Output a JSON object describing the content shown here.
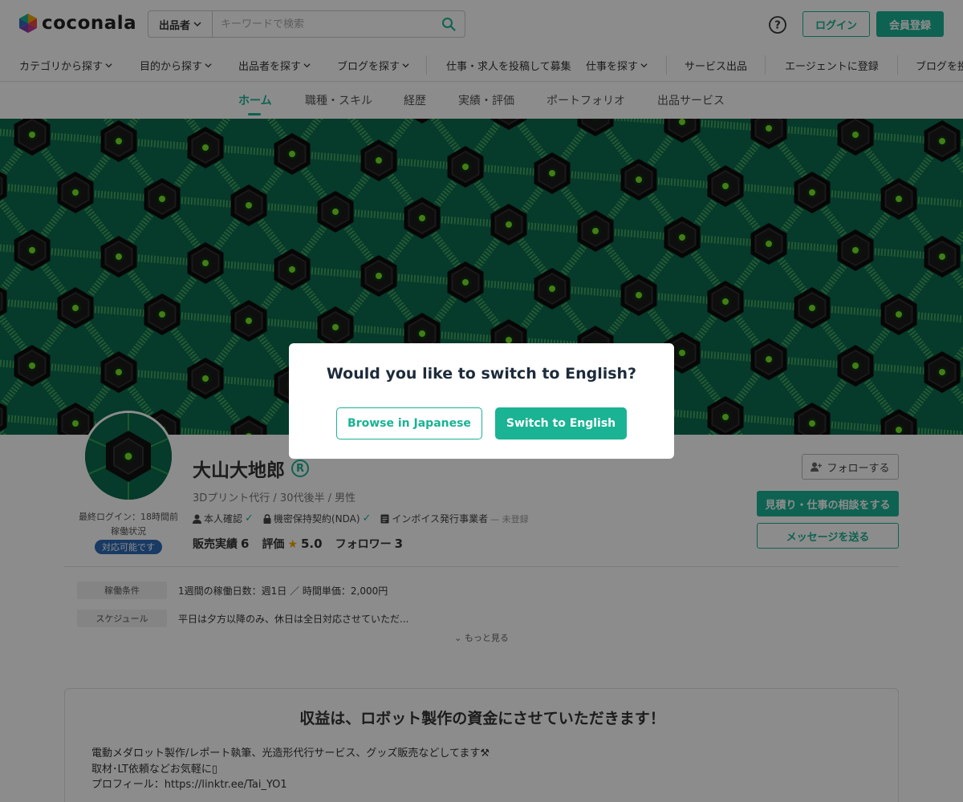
{
  "header": {
    "logo_text": "coconala",
    "search": {
      "type_label": "出品者",
      "placeholder": "キーワードで検索"
    },
    "login_label": "ログイン",
    "register_label": "会員登録",
    "help_icon": "help-circle-icon"
  },
  "global_nav": [
    {
      "label": "カテゴリから探す",
      "dropdown": true
    },
    {
      "label": "目的から探す",
      "dropdown": true
    },
    {
      "label": "出品者を探す",
      "dropdown": true
    },
    {
      "label": "ブログを探す",
      "dropdown": true
    },
    {
      "label": "仕事・求人を投稿して募集",
      "dropdown": false
    },
    {
      "label": "仕事を探す",
      "dropdown": true
    },
    {
      "label": "サービス出品",
      "dropdown": false
    },
    {
      "label": "エージェントに登録",
      "dropdown": false
    },
    {
      "label": "ブログを投",
      "dropdown": false
    }
  ],
  "profile_tabs": [
    {
      "label": "ホーム",
      "active": true
    },
    {
      "label": "職種・スキル",
      "active": false
    },
    {
      "label": "経歴",
      "active": false
    },
    {
      "label": "実績・評価",
      "active": false
    },
    {
      "label": "ポートフォリオ",
      "active": false
    },
    {
      "label": "出品サービス",
      "active": false
    }
  ],
  "profile": {
    "name": "大山大地郎",
    "reg_mark": "R",
    "subinfo": "3Dプリント代行 / 30代後半 / 男性",
    "last_login": "最終ログイン：18時間前",
    "work_status_label": "稼働状況",
    "availability": "対応可能です",
    "badges": {
      "identity": "本人確認",
      "nda": "機密保持契約(NDA)",
      "invoice": "インボイス発行事業者",
      "invoice_status": "未登録"
    },
    "stats": {
      "sales_label": "販売実績",
      "sales_value": "6",
      "rating_label": "評価",
      "rating_value": "5.0",
      "followers_label": "フォロワー",
      "followers_value": "3"
    },
    "follow_label": "フォローする",
    "consult_label": "見積り・仕事の相談をする",
    "message_label": "メッセージを送る"
  },
  "conditions": [
    {
      "label": "稼働条件",
      "value": "1週間の稼働日数：週1日 ／ 時間単価：2,000円"
    },
    {
      "label": "スケジュール",
      "value": "平日は夕方以降のみ、休日は全日対応させていただ..."
    }
  ],
  "more_label": "もっと見る",
  "intro": {
    "title": "収益は、ロボット製作の資金にさせていただきます！",
    "lines": [
      "電動メダロット製作/レポート執筆、光造形代行サービス、グッズ販売などしてます⚒",
      "取材･LT依頼などお気軽に▯",
      "プロフィール：https://linktr.ee/Tai_YO1"
    ]
  },
  "modal": {
    "title": "Would you like to switch to English?",
    "browse_japanese": "Browse in Japanese",
    "switch_english": "Switch to English"
  },
  "colors": {
    "accent": "#1ab394",
    "available_badge": "#2d6bb7",
    "cover_bg": "#0b6a4d"
  }
}
